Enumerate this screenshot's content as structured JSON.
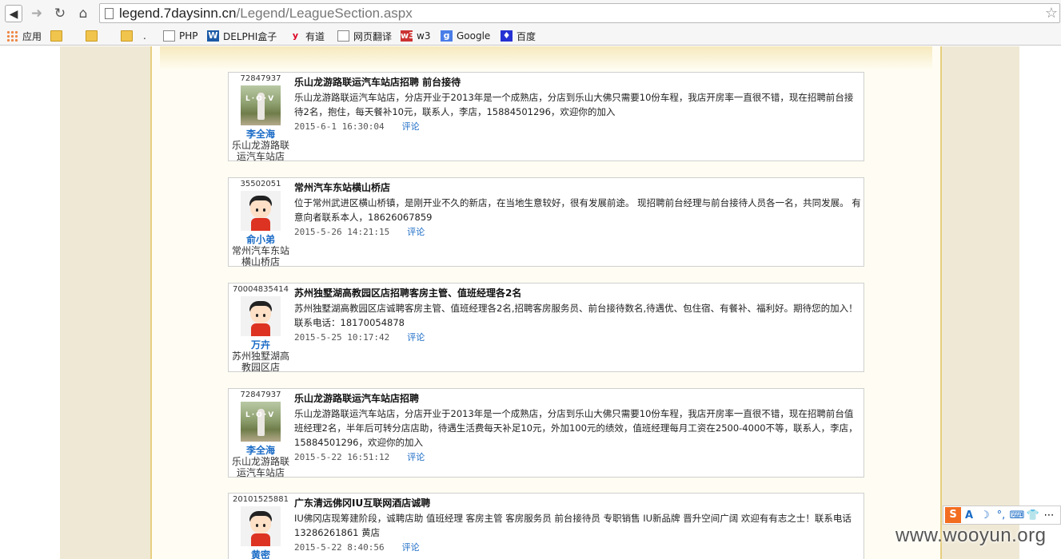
{
  "browser": {
    "url_host": "legend.7daysinn.cn",
    "url_path": "/Legend/LeagueSection.aspx"
  },
  "bookmarks": [
    {
      "label": "应用",
      "icon": "apps-icon"
    },
    {
      "label": "",
      "icon": "folder-icon"
    },
    {
      "label": "",
      "icon": "folder-icon"
    },
    {
      "label": ".",
      "icon": "folder-icon"
    },
    {
      "label": "PHP",
      "icon": "page-icon"
    },
    {
      "label": "DELPHI盒子",
      "icon": "delphi-icon"
    },
    {
      "label": "有道",
      "icon": "youdao-icon"
    },
    {
      "label": "网页翻译",
      "icon": "page-icon"
    },
    {
      "label": "w3",
      "icon": "w3-icon"
    },
    {
      "label": "Google",
      "icon": "google-icon"
    },
    {
      "label": "百度",
      "icon": "baidu-icon"
    }
  ],
  "posts": [
    {
      "uid": "72847937",
      "avatar": "photo",
      "user": "李全海",
      "store": "乐山龙游路联运汽车站店",
      "title": "乐山龙游路联运汽车站店招聘 前台接待",
      "body": "乐山龙游路联运汽车站店，分店开业于2013年是一个成熟店，分店到乐山大佛只需要10份车程，我店开房率一直很不错，现在招聘前台接待2名，抱住，每天餐补10元，联系人，李店，15884501296，欢迎你的加入",
      "date": "2015-6-1 16:30:04",
      "comment": "评论"
    },
    {
      "uid": "35502051",
      "avatar": "cartoon",
      "user": "俞小弟",
      "store": "常州汽车东站横山桥店",
      "title": "常州汽车东站横山桥店",
      "body": "位于常州武进区横山桥镇，是刚开业不久的新店，在当地生意较好，很有发展前途。 现招聘前台经理与前台接待人员各一名，共同发展。 有意向者联系本人，18626067859",
      "date": "2015-5-26 14:21:15",
      "comment": "评论"
    },
    {
      "uid": "70004835414",
      "avatar": "cartoon",
      "user": "万卉",
      "store": "苏州独墅湖高教园区店",
      "title": "苏州独墅湖高教园区店招聘客房主管、值班经理各2名",
      "body": "苏州独墅湖高教园区店诚聘客房主管、值班经理各2名,招聘客房服务员、前台接待数名,待遇优、包住宿、有餐补、福利好。期待您的加入！联系电话：18170054878",
      "date": "2015-5-25 10:17:42",
      "comment": "评论"
    },
    {
      "uid": "72847937",
      "avatar": "photo",
      "user": "李全海",
      "store": "乐山龙游路联运汽车站店",
      "title": "乐山龙游路联运汽车站店招聘",
      "body": "乐山龙游路联运汽车站店，分店开业于2013年是一个成熟店，分店到乐山大佛只需要10份车程，我店开房率一直很不错，现在招聘前台值班经理2名，半年后可转分店店助，待遇生活费每天补足10元，外加100元的绩效，值班经理每月工资在2500-4000不等，联系人，李店，15884501296，欢迎你的加入",
      "date": "2015-5-22 16:51:12",
      "comment": "评论"
    },
    {
      "uid": "20101525881",
      "avatar": "cartoon",
      "user": "黄密",
      "store": "",
      "title": "广东清远佛冈IU互联网酒店诚聘",
      "body": "IU佛冈店现筹建阶段，诚聘店助 值班经理 客房主管 客房服务员 前台接待员 专职销售 IU新品牌 晋升空间广阔 欢迎有有志之士！联系电话13286261861 黄店",
      "date": "2015-5-22 8:40:56",
      "comment": "评论"
    }
  ],
  "ime": {
    "logo": "S",
    "items": [
      "A",
      "☽",
      "°,",
      "⌨",
      "👕",
      "⋯"
    ]
  },
  "watermark": "www.wooyun.org"
}
